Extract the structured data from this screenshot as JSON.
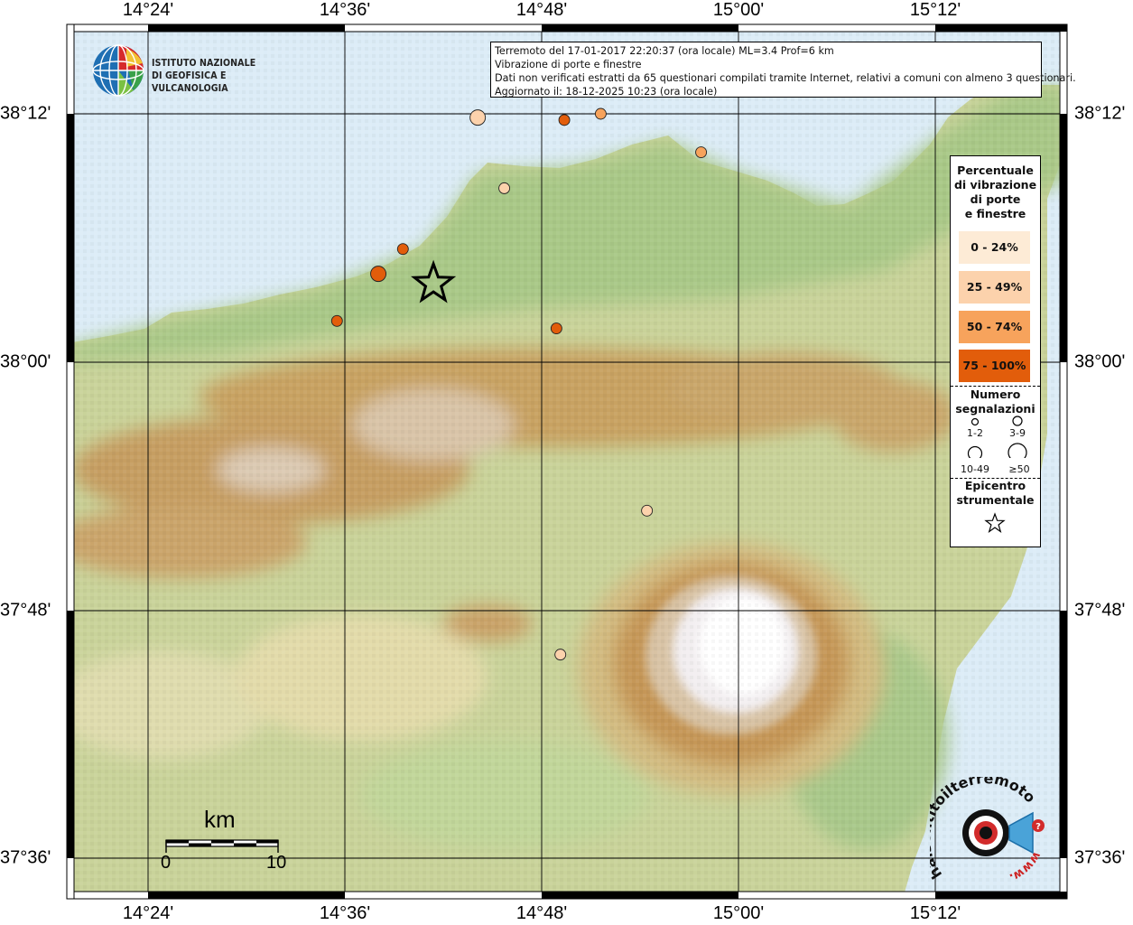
{
  "map": {
    "info": {
      "line1": "Terremoto del 17-01-2017 22:20:37 (ora locale) ML=3.4 Prof=6 km",
      "line2": "Vibrazione di porte e finestre",
      "line3": "Dati non verificati estratti da 65 questionari compilati tramite Internet, relativi a comuni con almeno 3 questionari.",
      "line4": "Aggiornato il: 18-12-2025 10:23 (ora locale)"
    },
    "ingv_logo": {
      "line1": "ISTITUTO NAZIONALE",
      "line2": "DI GEOFISICA E VULCANOLOGIA"
    },
    "axes": {
      "top": [
        "14°24'",
        "14°36'",
        "14°48'",
        "15°00'",
        "15°12'"
      ],
      "bottom": [
        "14°24'",
        "14°36'",
        "14°48'",
        "15°00'",
        "15°12'"
      ],
      "left": [
        "38°12'",
        "38°00'",
        "37°48'",
        "37°36'"
      ],
      "right": [
        "38°12'",
        "38°00'",
        "37°48'",
        "37°36'"
      ]
    },
    "scale": {
      "unit": "km",
      "start": "0",
      "end": "10"
    },
    "legend": {
      "title1": "Percentuale",
      "title2": "di vibrazione",
      "title3": "di porte",
      "title4": "e finestre",
      "classes": [
        {
          "label": "0 - 24%",
          "color": "#fdebd6"
        },
        {
          "label": "25 - 49%",
          "color": "#fcd2ac"
        },
        {
          "label": "50 - 74%",
          "color": "#f7a35c"
        },
        {
          "label": "75 - 100%",
          "color": "#e25d0b"
        }
      ],
      "count_title1": "Numero",
      "count_title2": "segnalazioni",
      "counts": [
        "1-2",
        "3-9",
        "10-49",
        "≥50"
      ],
      "epi_title1": "Epicentro",
      "epi_title2": "strumentale"
    },
    "hst_logo_text": "haisentitoilterremoto.it",
    "hst_logo_www": "www.",
    "points": [
      {
        "lon": 14.735,
        "lat": 38.197,
        "pct_class": 1,
        "size_class": 2
      },
      {
        "lon": 14.823,
        "lat": 38.195,
        "pct_class": 3,
        "size_class": 1
      },
      {
        "lon": 14.86,
        "lat": 38.2,
        "pct_class": 2,
        "size_class": 1
      },
      {
        "lon": 14.962,
        "lat": 38.169,
        "pct_class": 2,
        "size_class": 1
      },
      {
        "lon": 14.762,
        "lat": 38.14,
        "pct_class": 1,
        "size_class": 1
      },
      {
        "lon": 14.659,
        "lat": 38.091,
        "pct_class": 3,
        "size_class": 1
      },
      {
        "lon": 14.634,
        "lat": 38.071,
        "pct_class": 3,
        "size_class": 2
      },
      {
        "lon": 14.592,
        "lat": 38.033,
        "pct_class": 3,
        "size_class": 1
      },
      {
        "lon": 14.815,
        "lat": 38.027,
        "pct_class": 3,
        "size_class": 1
      },
      {
        "lon": 14.907,
        "lat": 37.88,
        "pct_class": 1,
        "size_class": 1
      },
      {
        "lon": 14.819,
        "lat": 37.764,
        "pct_class": 1,
        "size_class": 1
      }
    ],
    "epicenter": {
      "lon": 14.69,
      "lat": 38.063
    }
  }
}
